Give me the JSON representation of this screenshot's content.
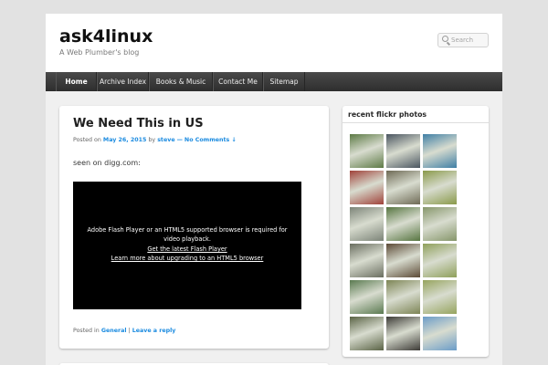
{
  "header": {
    "site_title": "ask4linux",
    "site_description": "A Web Plumber's blog",
    "search_placeholder": "Search"
  },
  "nav": {
    "items": [
      {
        "label": "Home",
        "active": true
      },
      {
        "label": "Archive Index"
      },
      {
        "label": "Books & Music"
      },
      {
        "label": "Contact Me"
      },
      {
        "label": "Sitemap"
      }
    ]
  },
  "post": {
    "title": "We Need This in US",
    "meta": {
      "posted_on": "Posted on",
      "date": "May 26, 2015",
      "by": "by",
      "author": "steve",
      "separator": "—",
      "comments": "No Comments ↓"
    },
    "body": "seen on digg.com:",
    "flash": {
      "message": "Adobe Flash Player or an HTML5 supported browser is required for video playback.",
      "link1": "Get the latest Flash Player",
      "link2": "Learn more about upgrading to an HTML5 browser"
    },
    "footer": {
      "posted_in": "Posted in",
      "category": "General",
      "pipe": "|",
      "reply": "Leave a reply"
    }
  },
  "sidebar": {
    "widget_title": "recent flickr photos",
    "photos": [
      {
        "icon": "flickr-photo-trees",
        "color": "#5d7a45"
      },
      {
        "icon": "flickr-photo-vehicle",
        "color": "#4a5560"
      },
      {
        "icon": "flickr-photo-lake",
        "color": "#3f7fa5"
      },
      {
        "icon": "flickr-photo-flowers",
        "color": "#a0423a"
      },
      {
        "icon": "flickr-photo-tree-trunk",
        "color": "#6e6a55"
      },
      {
        "icon": "flickr-photo-field",
        "color": "#8a9a4a"
      },
      {
        "icon": "flickr-photo-fence",
        "color": "#7c8478"
      },
      {
        "icon": "flickr-photo-bushes",
        "color": "#567540"
      },
      {
        "icon": "flickr-photo-pasture",
        "color": "#86966a"
      },
      {
        "icon": "flickr-photo-animals",
        "color": "#6a6e60"
      },
      {
        "icon": "flickr-photo-bison",
        "color": "#5c4a36"
      },
      {
        "icon": "flickr-photo-grassland",
        "color": "#8fa05a"
      },
      {
        "icon": "flickr-photo-hill",
        "color": "#5a7a50"
      },
      {
        "icon": "flickr-photo-deer-herd",
        "color": "#7d8555"
      },
      {
        "icon": "flickr-photo-meadow",
        "color": "#96a45e"
      },
      {
        "icon": "flickr-photo-antlers",
        "color": "#5a6345"
      },
      {
        "icon": "flickr-photo-zebra",
        "color": "#3c3a36"
      },
      {
        "icon": "flickr-photo-giraffe",
        "color": "#6a9cc8"
      }
    ]
  }
}
